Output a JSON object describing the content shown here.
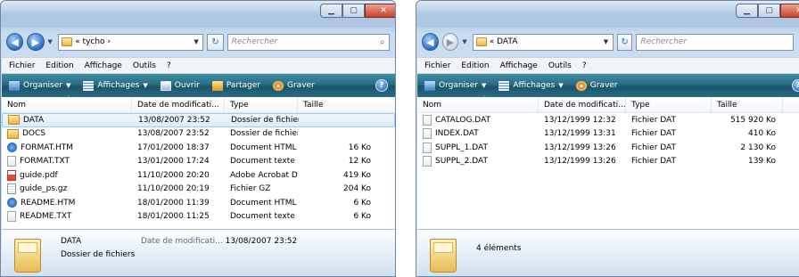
{
  "colors": {
    "accent": "#2a6d84",
    "selection": "#dcecfc",
    "frame": "#a9c3df"
  },
  "window1": {
    "address": "« tycho ›",
    "search_placeholder": "Rechercher",
    "menu": [
      "Fichier",
      "Edition",
      "Affichage",
      "Outils",
      "?"
    ],
    "toolbar": [
      {
        "label": "Organiser",
        "icon": "organize-icon",
        "dropdown": true
      },
      {
        "label": "Affichages",
        "icon": "views-icon",
        "dropdown": true
      },
      {
        "label": "Ouvrir",
        "icon": "open-icon",
        "dropdown": false
      },
      {
        "label": "Partager",
        "icon": "share-icon",
        "dropdown": false
      },
      {
        "label": "Graver",
        "icon": "burn-icon",
        "dropdown": false
      }
    ],
    "columns": [
      "Nom",
      "Date de modificati...",
      "Type",
      "Taille"
    ],
    "rows": [
      {
        "name": "DATA",
        "date": "13/08/2007 23:52",
        "type": "Dossier de fichiers",
        "size": "",
        "icon": "folder-icon",
        "selected": true
      },
      {
        "name": "DOCS",
        "date": "13/08/2007 23:52",
        "type": "Dossier de fichiers",
        "size": "",
        "icon": "folder-icon",
        "selected": false
      },
      {
        "name": "FORMAT.HTM",
        "date": "17/01/2000 18:37",
        "type": "Document HTML",
        "size": "16 Ko",
        "icon": "html-file-icon",
        "selected": false
      },
      {
        "name": "FORMAT.TXT",
        "date": "13/01/2000 17:24",
        "type": "Document texte",
        "size": "12 Ko",
        "icon": "text-file-icon",
        "selected": false
      },
      {
        "name": "guide.pdf",
        "date": "11/10/2000 20:20",
        "type": "Adobe Acrobat D...",
        "size": "419 Ko",
        "icon": "pdf-file-icon",
        "selected": false
      },
      {
        "name": "guide_ps.gz",
        "date": "11/10/2000 20:19",
        "type": "Fichier GZ",
        "size": "204 Ko",
        "icon": "gz-file-icon",
        "selected": false
      },
      {
        "name": "README.HTM",
        "date": "18/01/2000 11:39",
        "type": "Document HTML",
        "size": "6 Ko",
        "icon": "html-file-icon",
        "selected": false
      },
      {
        "name": "README.TXT",
        "date": "18/01/2000 11:25",
        "type": "Document texte",
        "size": "6 Ko",
        "icon": "text-file-icon",
        "selected": false
      }
    ],
    "details": {
      "name": "DATA",
      "kind": "Dossier de fichiers",
      "date_label": "Date de modificati...",
      "date_value": "13/08/2007 23:52"
    }
  },
  "window2": {
    "address": "« DATA",
    "search_placeholder": "Rechercher",
    "menu": [
      "Fichier",
      "Edition",
      "Affichage",
      "Outils",
      "?"
    ],
    "toolbar": [
      {
        "label": "Organiser",
        "icon": "organize-icon",
        "dropdown": true
      },
      {
        "label": "Affichages",
        "icon": "views-icon",
        "dropdown": true
      },
      {
        "label": "Graver",
        "icon": "burn-icon",
        "dropdown": false
      }
    ],
    "columns": [
      "Nom",
      "Date de modificati...",
      "Type",
      "Taille"
    ],
    "rows": [
      {
        "name": "CATALOG.DAT",
        "date": "13/12/1999 12:32",
        "type": "Fichier DAT",
        "size": "515 920 Ko",
        "icon": "dat-file-icon"
      },
      {
        "name": "INDEX.DAT",
        "date": "13/12/1999 13:31",
        "type": "Fichier DAT",
        "size": "410 Ko",
        "icon": "dat-file-icon"
      },
      {
        "name": "SUPPL_1.DAT",
        "date": "13/12/1999 13:26",
        "type": "Fichier DAT",
        "size": "2 130 Ko",
        "icon": "dat-file-icon"
      },
      {
        "name": "SUPPL_2.DAT",
        "date": "13/12/1999 13:26",
        "type": "Fichier DAT",
        "size": "139 Ko",
        "icon": "dat-file-icon"
      }
    ],
    "details": {
      "count": "4 éléments"
    }
  }
}
